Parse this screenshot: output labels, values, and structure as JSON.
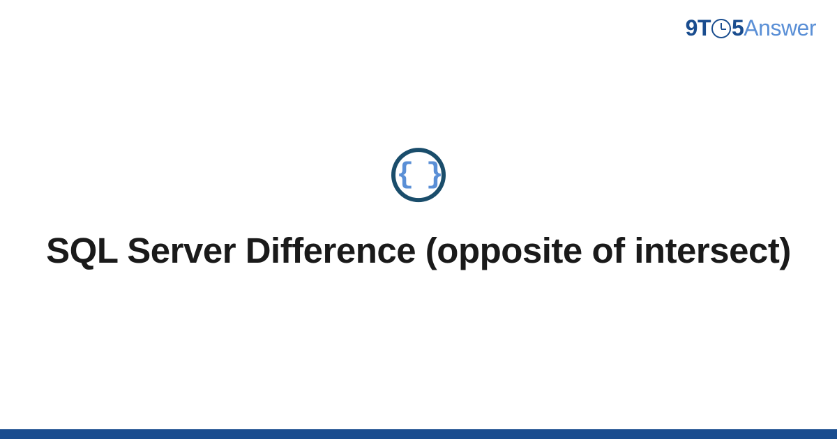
{
  "logo": {
    "part1": "9T",
    "part2": "5",
    "part3": "Answer"
  },
  "icon": {
    "braces": "{ }"
  },
  "title": "SQL Server Difference (opposite of intersect)"
}
